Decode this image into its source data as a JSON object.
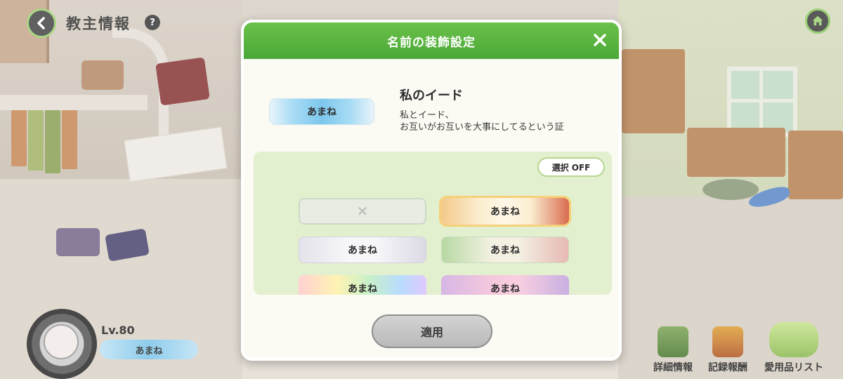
{
  "header": {
    "title": "教主情報",
    "help_glyph": "?"
  },
  "profile": {
    "level": "Lv.80",
    "plate_name": "あまね"
  },
  "menu": [
    {
      "label": "詳細情報",
      "icon": "book-icon"
    },
    {
      "label": "記録報酬",
      "icon": "treasure-chest-icon"
    },
    {
      "label": "愛用品リスト",
      "icon": "stuffed-toy-icon"
    }
  ],
  "modal": {
    "title": "名前の装飾設定",
    "preview_name": "あまね",
    "decoration_name": "私のイード",
    "description_line1": "私とイード、",
    "description_line2": "お互いがお互いを大事にしてるという証",
    "select_off_label": "選択 OFF",
    "apply_label": "適用",
    "none_glyph": "✕",
    "plates": [
      {
        "name": "あまね",
        "style": "gold-red"
      },
      {
        "name": "あまね",
        "style": "white-silver"
      },
      {
        "name": "あまね",
        "style": "green-floral"
      },
      {
        "name": "あまね",
        "style": "rainbow"
      },
      {
        "name": "あまね",
        "style": "pink-purple"
      }
    ]
  },
  "colors": {
    "header_green": "#4aa738",
    "panel_green": "#e3f0cf",
    "apply_gray": "#c4c4c4"
  }
}
